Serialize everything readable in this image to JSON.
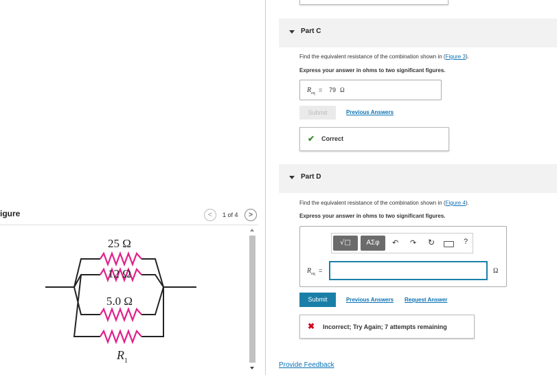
{
  "figure": {
    "title": "igure",
    "counter": "1 of 4",
    "prev_icon": "chevron-left-icon",
    "next_icon": "chevron-right-icon",
    "resistors": [
      {
        "label": "25 Ω"
      },
      {
        "label": "12 Ω"
      },
      {
        "label": "5.0 Ω"
      },
      {
        "label": "R",
        "subscript": "1"
      }
    ],
    "resistor_color": "#e0208a"
  },
  "partC": {
    "title": "Part C",
    "question_prefix": "Find the equivalent resistance of the combination shown in (",
    "figure_link": "Figure 3",
    "question_suffix": ").",
    "instruction": "Express your answer in ohms to two significant figures.",
    "answer_var": "R",
    "answer_sub": "eq",
    "answer_eq": " = ",
    "answer_value": "79",
    "answer_unit": "Ω",
    "submit_label": "Submit",
    "previous_answers": "Previous Answers",
    "feedback": "Correct",
    "feedback_icon": "checkmark-icon"
  },
  "partD": {
    "title": "Part D",
    "question_prefix": "Find the equivalent resistance of the combination shown in (",
    "figure_link": "Figure 4",
    "question_suffix": ").",
    "instruction": "Express your answer in ohms to two significant figures.",
    "toolbar": {
      "templates_label": "√□",
      "symbols_label": "ΑΣφ",
      "undo_icon": "undo-icon",
      "redo_icon": "redo-icon",
      "reset_icon": "reset-icon",
      "keyboard_icon": "keyboard-icon",
      "help_label": "?"
    },
    "answer_var": "R",
    "answer_sub": "eq",
    "answer_eq": " =",
    "input_value": "",
    "unit": "Ω",
    "submit_label": "Submit",
    "previous_answers": "Previous Answers",
    "request_answer": "Request Answer",
    "feedback": "Incorrect; Try Again; 7 attempts remaining",
    "feedback_icon": "x-icon"
  },
  "footer": {
    "provide_feedback": "Provide Feedback"
  },
  "colors": {
    "link": "#0b72b5",
    "submit_active": "#1a7fa8",
    "correct": "#3a8c2f",
    "incorrect": "#d0021b",
    "focus_border": "#1a7fa8"
  }
}
